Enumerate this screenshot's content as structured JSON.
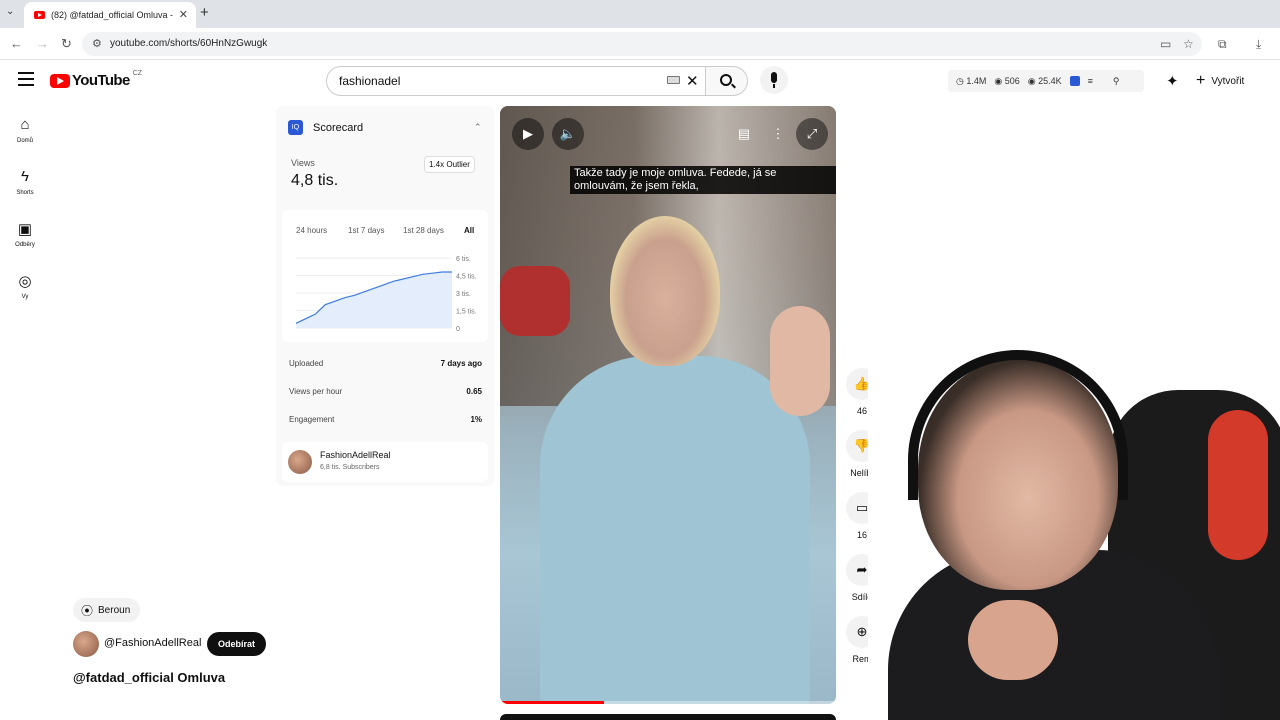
{
  "browser": {
    "tab_title": "(82) @fatdad_official Omluva -",
    "url": "youtube.com/shorts/60HnNzGwugk"
  },
  "header": {
    "logo_text": "YouTube",
    "region": "CZ",
    "search_value": "fashionadel",
    "ext_stats": {
      "views": "1.4M",
      "likes": "506",
      "comments": "25.4K"
    },
    "create_label": "Vytvořit"
  },
  "sidebar": {
    "items": [
      {
        "label": "Domů",
        "icon": "home-icon"
      },
      {
        "label": "Shorts",
        "icon": "shorts-icon"
      },
      {
        "label": "Odběry",
        "icon": "subscriptions-icon"
      },
      {
        "label": "Vy",
        "icon": "you-icon"
      }
    ]
  },
  "scorecard": {
    "title": "Scorecard",
    "views_label": "Views",
    "views_value": "4,8 tis.",
    "outlier": "1.4x Outlier",
    "ranges": [
      "24 hours",
      "1st 7 days",
      "1st 28 days",
      "All"
    ],
    "active_range": "All",
    "uploaded_label": "Uploaded",
    "uploaded_value": "7 days ago",
    "vph_label": "Views per hour",
    "vph_value": "0.65",
    "engagement_label": "Engagement",
    "engagement_value": "1%",
    "channel_name": "FashionAdellReal",
    "channel_subs": "6,8 tis. Subscribers"
  },
  "chart_data": {
    "type": "area",
    "x": [
      0,
      1,
      2,
      3,
      4,
      5,
      6,
      7,
      8,
      9,
      10,
      11,
      12,
      13,
      14,
      15,
      16
    ],
    "y": [
      400,
      800,
      1200,
      2000,
      2300,
      2600,
      2800,
      3100,
      3400,
      3700,
      4000,
      4200,
      4400,
      4600,
      4700,
      4800,
      4800
    ],
    "y_tick_labels": [
      "6 tis.",
      "4,5 tis.",
      "3 tis.",
      "1,5 tis.",
      "0"
    ],
    "y_tick_values": [
      6000,
      4500,
      3000,
      1500,
      0
    ],
    "ylim": [
      0,
      6000
    ],
    "color": "#3d7be0",
    "grid": true
  },
  "video": {
    "caption": "Takže tady je moje omluva. Fedede, já se omlouvám, že jsem řekla,",
    "progress": 0.31
  },
  "actions": {
    "like_count": "46",
    "dislike_label": "Nelíbí",
    "comments_count": "16",
    "share_label": "Sdíle",
    "remix_label": "Rem"
  },
  "info": {
    "location": "Beroun",
    "channel_handle": "@FashionAdellReal",
    "subscribe_label": "Odebírat",
    "title": "@fatdad_official Omluva"
  }
}
